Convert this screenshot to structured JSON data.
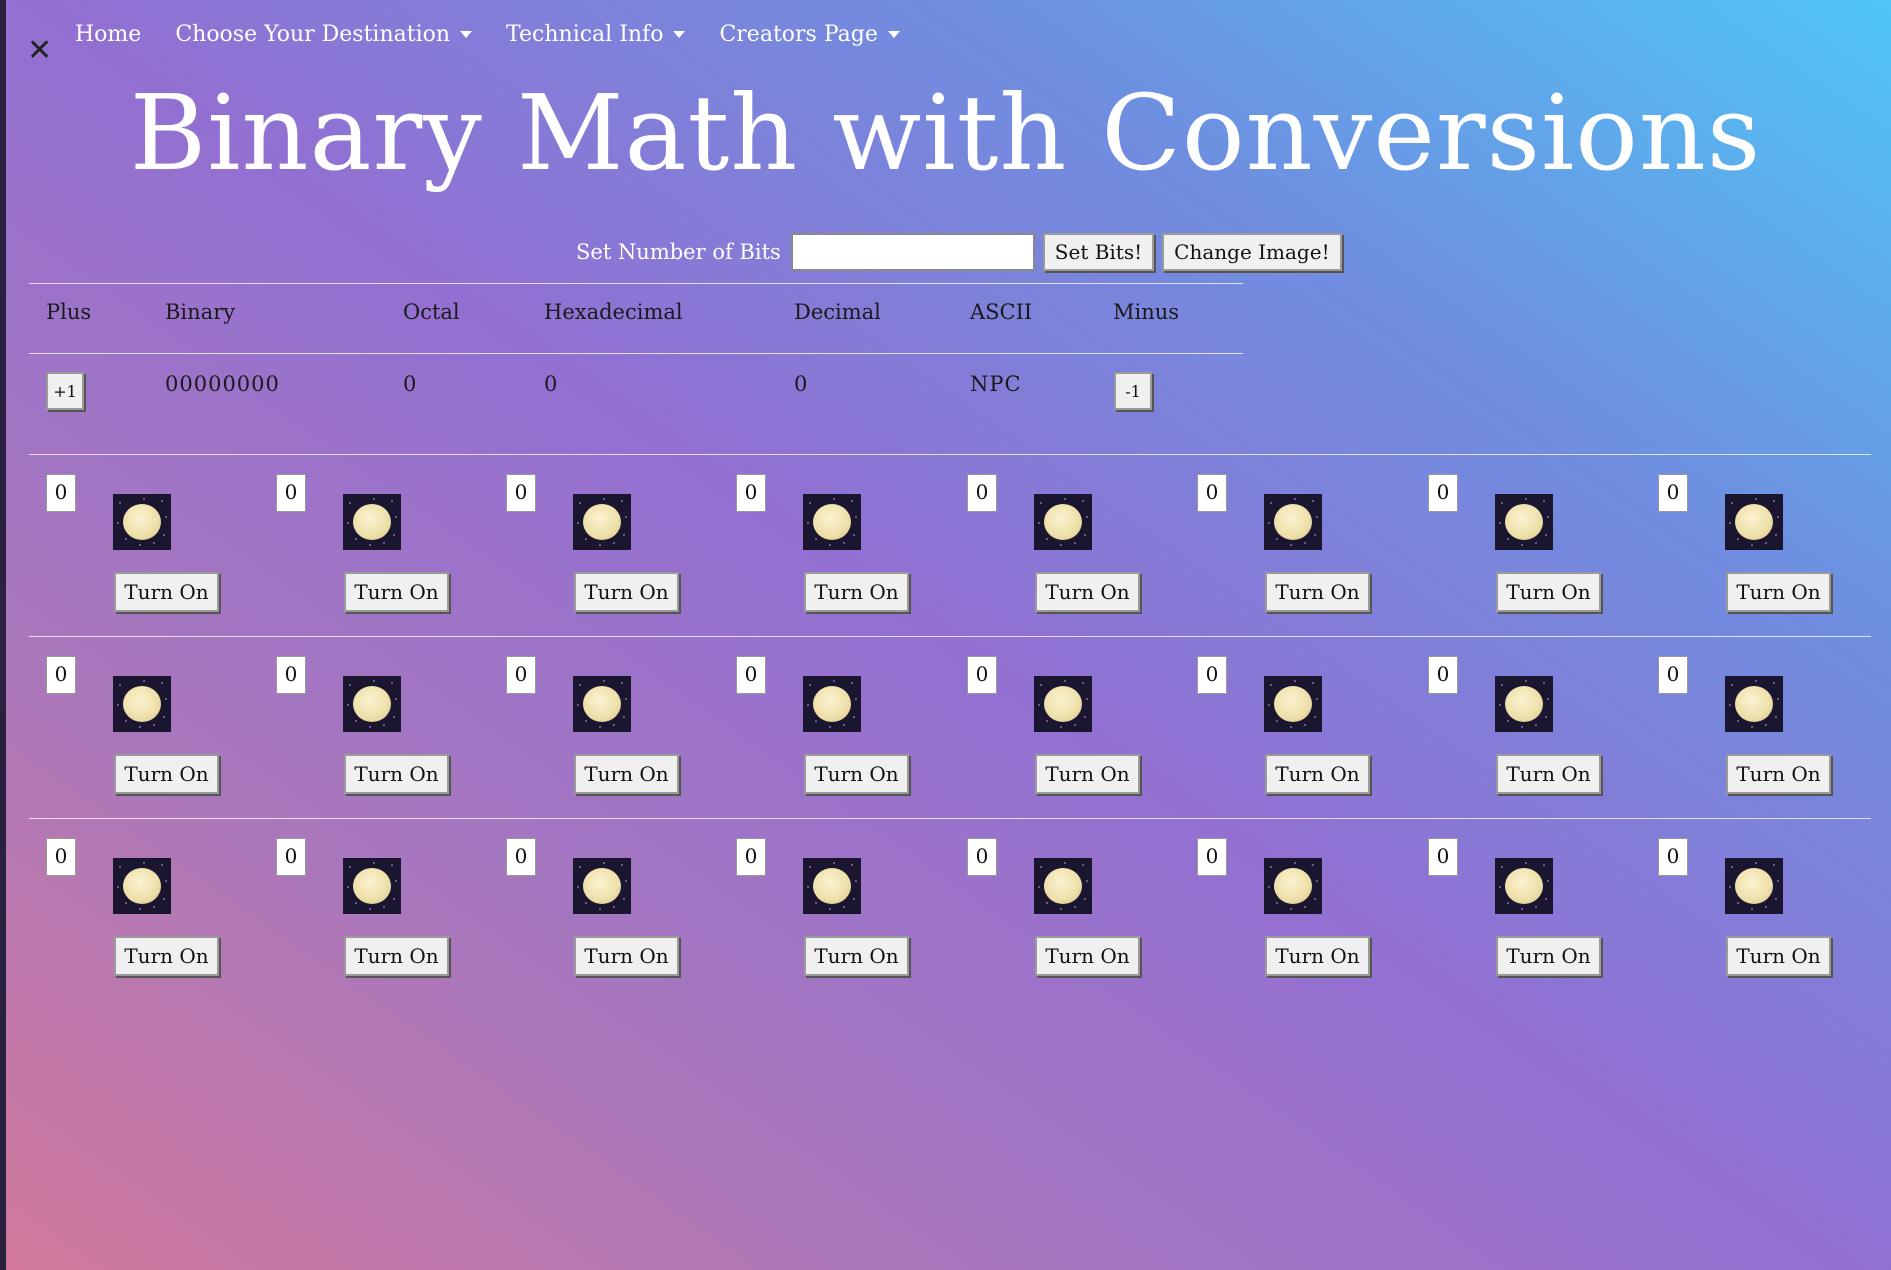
{
  "nav": {
    "close_icon": "close-icon",
    "items": [
      {
        "label": "Home",
        "dropdown": false
      },
      {
        "label": "Choose Your Destination",
        "dropdown": true
      },
      {
        "label": "Technical Info",
        "dropdown": true
      },
      {
        "label": "Creators Page",
        "dropdown": true
      }
    ]
  },
  "title": "Binary Math with Conversions",
  "set_bits": {
    "label": "Set Number of Bits",
    "input_value": "",
    "set_button": "Set Bits!",
    "change_image_button": "Change Image!"
  },
  "table": {
    "headers": [
      "Plus",
      "Binary",
      "Octal",
      "Hexadecimal",
      "Decimal",
      "ASCII",
      "Minus"
    ],
    "plus_button": "+1",
    "minus_button": "-1",
    "values": {
      "binary": "00000000",
      "octal": "0",
      "hexadecimal": "0",
      "decimal": "0",
      "ascii": "NPC"
    }
  },
  "bit_rows": [
    [
      {
        "value": "0",
        "button": "Turn On"
      },
      {
        "value": "0",
        "button": "Turn On"
      },
      {
        "value": "0",
        "button": "Turn On"
      },
      {
        "value": "0",
        "button": "Turn On"
      },
      {
        "value": "0",
        "button": "Turn On"
      },
      {
        "value": "0",
        "button": "Turn On"
      },
      {
        "value": "0",
        "button": "Turn On"
      },
      {
        "value": "0",
        "button": "Turn On"
      }
    ],
    [
      {
        "value": "0",
        "button": "Turn On"
      },
      {
        "value": "0",
        "button": "Turn On"
      },
      {
        "value": "0",
        "button": "Turn On"
      },
      {
        "value": "0",
        "button": "Turn On"
      },
      {
        "value": "0",
        "button": "Turn On"
      },
      {
        "value": "0",
        "button": "Turn On"
      },
      {
        "value": "0",
        "button": "Turn On"
      },
      {
        "value": "0",
        "button": "Turn On"
      }
    ],
    [
      {
        "value": "0",
        "button": "Turn On"
      },
      {
        "value": "0",
        "button": "Turn On"
      },
      {
        "value": "0",
        "button": "Turn On"
      },
      {
        "value": "0",
        "button": "Turn On"
      },
      {
        "value": "0",
        "button": "Turn On"
      },
      {
        "value": "0",
        "button": "Turn On"
      },
      {
        "value": "0",
        "button": "Turn On"
      },
      {
        "value": "0",
        "button": "Turn On"
      }
    ]
  ],
  "bit_image_icon": "moon-icon",
  "colors": {
    "gradient_start": "#d2799b",
    "gradient_mid": "#9270d2",
    "gradient_end": "#4fc6f7",
    "title_text": "#ffffff"
  }
}
